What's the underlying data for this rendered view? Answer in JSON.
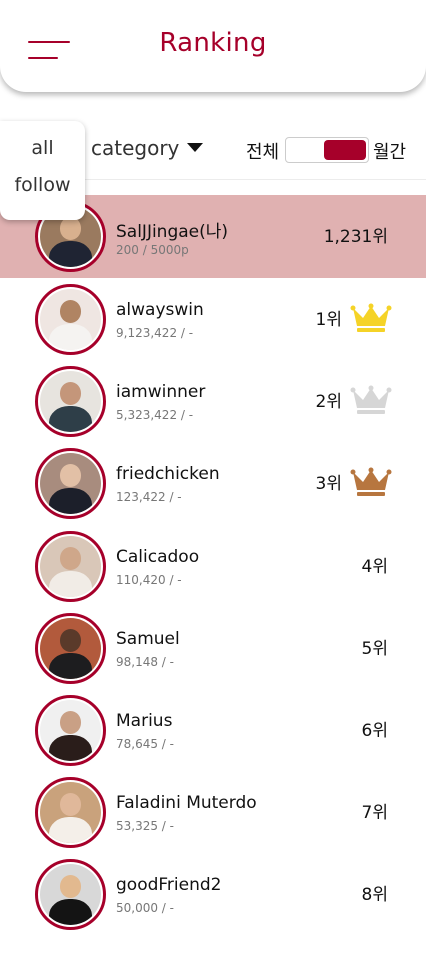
{
  "header": {
    "title": "Ranking"
  },
  "filter": {
    "category_label": "category",
    "dropdown_options": [
      "all",
      "follow"
    ],
    "toggle_left": "전체",
    "toggle_right": "월간"
  },
  "me": {
    "name": "SalJJingae(나)",
    "sub": "200 / 5000p",
    "rank": "1,231위"
  },
  "ranking": [
    {
      "name": "alwayswin",
      "sub": "9,123,422 / -",
      "rank": "1위",
      "crown": "gold-crown-icon"
    },
    {
      "name": "iamwinner",
      "sub": "5,323,422 / -",
      "rank": "2위",
      "crown": "silver-crown-icon"
    },
    {
      "name": "friedchicken",
      "sub": "123,422 / -",
      "rank": "3위",
      "crown": "bronze-crown-icon"
    },
    {
      "name": "Calicadoo",
      "sub": "110,420 / -",
      "rank": "4위"
    },
    {
      "name": "Samuel",
      "sub": "98,148 / -",
      "rank": "5위"
    },
    {
      "name": "Marius",
      "sub": "78,645 / -",
      "rank": "6위"
    },
    {
      "name": "Faladini Muterdo",
      "sub": "53,325 / -",
      "rank": "7위"
    },
    {
      "name": "goodFriend2",
      "sub": "50,000 / -",
      "rank": "8위"
    }
  ],
  "colors": {
    "accent": "#a6002a",
    "highlight_row": "#e0b1b1",
    "gold": "#f5d327",
    "silver": "#d6d6d6",
    "bronze": "#b7763f"
  }
}
